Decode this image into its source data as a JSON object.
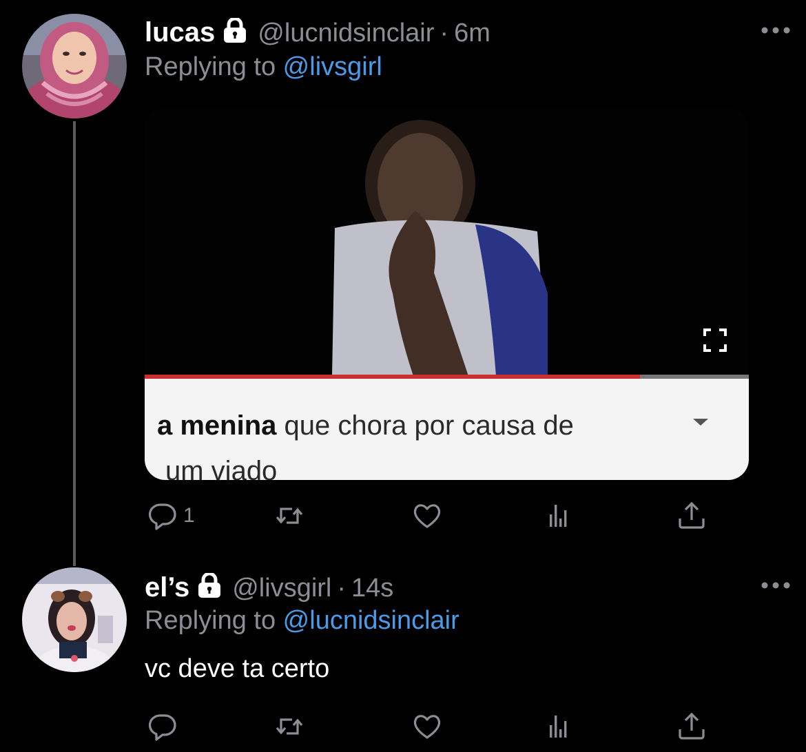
{
  "colors": {
    "background": "#000000",
    "secondary_text": "#8b8f94",
    "link": "#4b9be8",
    "thread_line": "#5b5b5b"
  },
  "tweets": [
    {
      "display_name": "lucas",
      "protected_icon": "lock-icon",
      "handle": "@lucnidsinclair",
      "separator": "·",
      "time": "6m",
      "replying_prefix": "Replying to ",
      "replying_to": "@livsgirl",
      "media": {
        "caption_bold": "a menina",
        "caption_rest": " que chora por causa de",
        "caption_line2": "um viado",
        "expand_icon": "fullscreen-icon",
        "video_progress": 0.82
      },
      "actions": {
        "reply_icon": "reply-icon",
        "reply_count": "1",
        "retweet_icon": "retweet-icon",
        "like_icon": "heart-icon",
        "stats_icon": "analytics-icon",
        "share_icon": "share-icon"
      }
    },
    {
      "display_name": "el’s",
      "protected_icon": "lock-icon",
      "handle": "@livsgirl",
      "separator": "·",
      "time": "14s",
      "replying_prefix": "Replying to ",
      "replying_to": "@lucnidsinclair",
      "text": "vc deve ta certo",
      "actions": {
        "reply_icon": "reply-icon",
        "retweet_icon": "retweet-icon",
        "like_icon": "heart-icon",
        "stats_icon": "analytics-icon",
        "share_icon": "share-icon"
      }
    }
  ]
}
